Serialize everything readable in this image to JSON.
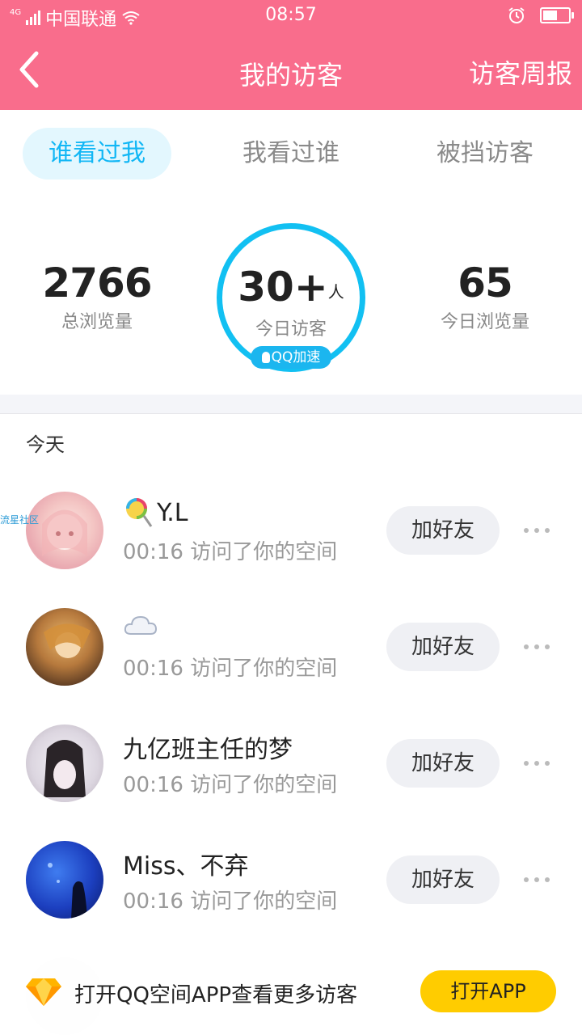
{
  "status_bar": {
    "network_type": "4G",
    "carrier": "中国联通",
    "time": "08:57",
    "battery_level": 0.55
  },
  "nav": {
    "title": "我的访客",
    "weekly_report": "访客周报",
    "back_icon": "chevron-left-icon"
  },
  "tabs": [
    {
      "label": "谁看过我",
      "active": true
    },
    {
      "label": "我看过谁",
      "active": false
    },
    {
      "label": "被挡访客",
      "active": false
    }
  ],
  "stats": {
    "total_views": {
      "value": "2766",
      "label": "总浏览量"
    },
    "today_visitors": {
      "value": "30+",
      "unit": "人",
      "label": "今日访客"
    },
    "today_views": {
      "value": "65",
      "label": "今日浏览量"
    },
    "badge": "QQ加速"
  },
  "section_label": "今天",
  "visitors": [
    {
      "name": "Y.L",
      "name_icon": "lollipop-icon",
      "subtitle": "00:16 访问了你的空间",
      "action": "加好友",
      "avatar_watermark": "流星社区"
    },
    {
      "name": "",
      "name_icon": "cloud-icon",
      "subtitle": "00:16 访问了你的空间",
      "action": "加好友"
    },
    {
      "name": "九亿班主任的梦",
      "subtitle": "00:16 访问了你的空间",
      "action": "加好友"
    },
    {
      "name": "Miss、不弃",
      "subtitle": "00:16 访问了你的空间",
      "action": "加好友"
    }
  ],
  "banner": {
    "text": "打开QQ空间APP查看更多访客",
    "button": "打开APP",
    "icon": "diamond-icon"
  },
  "colors": {
    "header": "#f96d8c",
    "accent": "#12b7f5",
    "ring": "#12c0f2",
    "button_yellow": "#ffcc00"
  }
}
